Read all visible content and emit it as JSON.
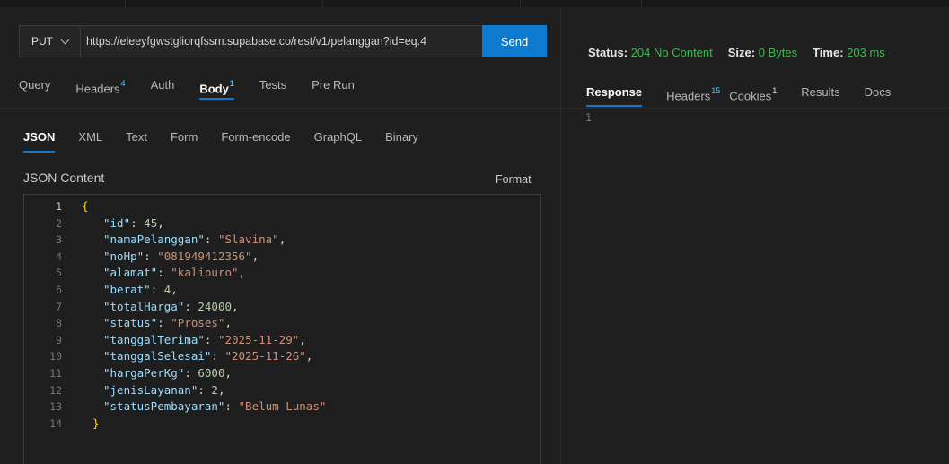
{
  "request": {
    "method": "PUT",
    "url": "https://eleeyfgwstgliorqfssm.supabase.co/rest/v1/pelanggan?id=eq.4",
    "send_label": "Send",
    "tabs": [
      {
        "label": "Query",
        "badge": ""
      },
      {
        "label": "Headers",
        "badge": "4"
      },
      {
        "label": "Auth",
        "badge": ""
      },
      {
        "label": "Body",
        "badge": "1"
      },
      {
        "label": "Tests",
        "badge": ""
      },
      {
        "label": "Pre Run",
        "badge": ""
      }
    ],
    "body_types": [
      "JSON",
      "XML",
      "Text",
      "Form",
      "Form-encode",
      "GraphQL",
      "Binary"
    ],
    "content_label": "JSON Content",
    "format_label": "Format",
    "line_numbers": [
      "1",
      "2",
      "3",
      "4",
      "5",
      "6",
      "7",
      "8",
      "9",
      "10",
      "11",
      "12",
      "13",
      "14"
    ],
    "json_body": [
      {
        "key": "id",
        "value": "45",
        "type": "number"
      },
      {
        "key": "namaPelanggan",
        "value": "\"Slavina\"",
        "type": "string"
      },
      {
        "key": "noHp",
        "value": "\"081949412356\"",
        "type": "string"
      },
      {
        "key": "alamat",
        "value": "\"kalipuro\"",
        "type": "string"
      },
      {
        "key": "berat",
        "value": "4",
        "type": "number"
      },
      {
        "key": "totalHarga",
        "value": "24000",
        "type": "number"
      },
      {
        "key": "status",
        "value": "\"Proses\"",
        "type": "string"
      },
      {
        "key": "tanggalTerima",
        "value": "\"2025-11-29\"",
        "type": "string"
      },
      {
        "key": "tanggalSelesai",
        "value": "\"2025-11-26\"",
        "type": "string"
      },
      {
        "key": "hargaPerKg",
        "value": "6000",
        "type": "number"
      },
      {
        "key": "jenisLayanan",
        "value": "2",
        "type": "number"
      },
      {
        "key": "statusPembayaran",
        "value": "\"Belum Lunas\"",
        "type": "string"
      }
    ]
  },
  "response": {
    "status_label": "Status:",
    "status_value": "204 No Content",
    "size_label": "Size:",
    "size_value": "0 Bytes",
    "time_label": "Time:",
    "time_value": "203 ms",
    "tabs": [
      {
        "label": "Response",
        "badge": ""
      },
      {
        "label": "Headers",
        "badge": "15"
      },
      {
        "label": "Cookies",
        "badge": "1"
      },
      {
        "label": "Results",
        "badge": ""
      },
      {
        "label": "Docs",
        "badge": ""
      }
    ],
    "line_number": "1"
  },
  "colors": {
    "accent": "#0e7bd1",
    "status_ok": "#3fb950",
    "json_key": "#9cdcfe",
    "json_string": "#ce9178",
    "json_number": "#b5cea8"
  }
}
